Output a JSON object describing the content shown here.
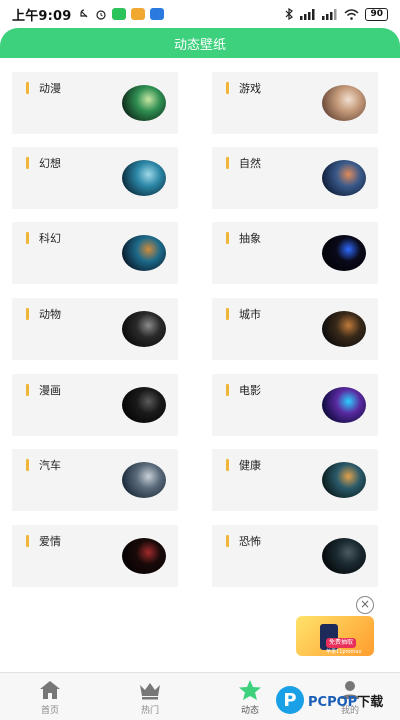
{
  "status_bar": {
    "time": "上午9:09",
    "battery": "90"
  },
  "header": {
    "title": "动态壁纸"
  },
  "categories": [
    {
      "label": "动漫",
      "thumb_colors": [
        "#0f2a1a",
        "#2f8f52",
        "#c8e6a3"
      ]
    },
    {
      "label": "游戏",
      "thumb_colors": [
        "#6b4a3a",
        "#c49a7a",
        "#f0e0d0"
      ]
    },
    {
      "label": "幻想",
      "thumb_colors": [
        "#0c2b3d",
        "#2b86a6",
        "#9fd8e8"
      ]
    },
    {
      "label": "自然",
      "thumb_colors": [
        "#0f1e3a",
        "#3b5a8a",
        "#e08a5a"
      ]
    },
    {
      "label": "科幻",
      "thumb_colors": [
        "#0a1a2a",
        "#1d6a8a",
        "#d08a3a"
      ]
    },
    {
      "label": "抽象",
      "thumb_colors": [
        "#020208",
        "#0a0a1a",
        "#2f6aff"
      ]
    },
    {
      "label": "动物",
      "thumb_colors": [
        "#0a0a0a",
        "#2a2a2a",
        "#8a8a8a"
      ]
    },
    {
      "label": "城市",
      "thumb_colors": [
        "#0a0a0a",
        "#3a2a1a",
        "#c07a3a"
      ]
    },
    {
      "label": "漫画",
      "thumb_colors": [
        "#050505",
        "#1a1a1a",
        "#5a5a5a"
      ]
    },
    {
      "label": "电影",
      "thumb_colors": [
        "#0a0a3a",
        "#5a2aa0",
        "#2ad0ff"
      ]
    },
    {
      "label": "汽车",
      "thumb_colors": [
        "#1a2a3a",
        "#5a6a7a",
        "#c8d0d8"
      ]
    },
    {
      "label": "健康",
      "thumb_colors": [
        "#0a1a1a",
        "#2a5a6a",
        "#e0a04a"
      ]
    },
    {
      "label": "爱情",
      "thumb_colors": [
        "#050202",
        "#1a0a0a",
        "#a02a2a"
      ]
    },
    {
      "label": "恐怖",
      "thumb_colors": [
        "#05080a",
        "#1a2a30",
        "#4a5a60"
      ]
    }
  ],
  "ad": {
    "tag": "免费抽取",
    "sub": "苹果11promax"
  },
  "nav": [
    {
      "label": "首页",
      "icon": "home-icon"
    },
    {
      "label": "热门",
      "icon": "crown-icon"
    },
    {
      "label": "动态",
      "icon": "star-icon"
    },
    {
      "label": "我的",
      "icon": "user-icon"
    }
  ],
  "watermark": {
    "brand": "PCPOP",
    "suffix": "下载"
  },
  "colors": {
    "accent": "#3dd07d",
    "label_bar": "#f1b53a"
  }
}
